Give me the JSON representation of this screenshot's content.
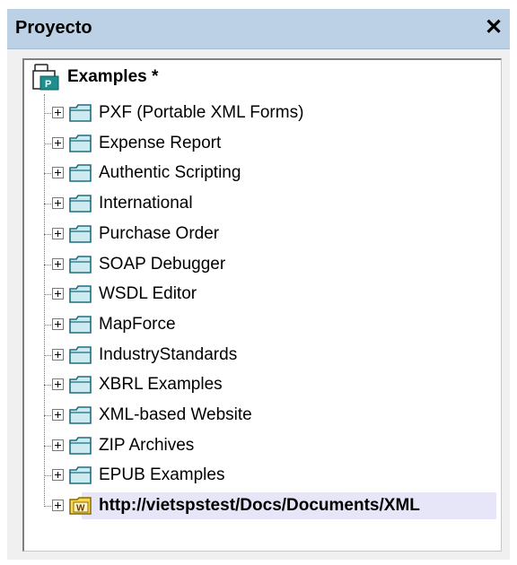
{
  "window": {
    "title": "Proyecto",
    "close_glyph": "✕"
  },
  "tree": {
    "root": {
      "label": "Examples  *",
      "icon": "project-icon"
    },
    "items": [
      {
        "label": "PXF (Portable XML Forms)",
        "icon": "folder-icon"
      },
      {
        "label": "Expense Report",
        "icon": "folder-icon"
      },
      {
        "label": "Authentic Scripting",
        "icon": "folder-icon"
      },
      {
        "label": "International",
        "icon": "folder-icon"
      },
      {
        "label": "Purchase Order",
        "icon": "folder-icon"
      },
      {
        "label": "SOAP Debugger",
        "icon": "folder-icon"
      },
      {
        "label": "WSDL Editor",
        "icon": "folder-icon"
      },
      {
        "label": "MapForce",
        "icon": "folder-icon"
      },
      {
        "label": "IndustryStandards",
        "icon": "folder-icon"
      },
      {
        "label": "XBRL Examples",
        "icon": "folder-icon"
      },
      {
        "label": "XML-based Website",
        "icon": "folder-icon"
      },
      {
        "label": "ZIP Archives",
        "icon": "folder-icon"
      },
      {
        "label": "EPUB Examples",
        "icon": "folder-icon"
      },
      {
        "label": "http://vietspstest/Docs/Documents/XML",
        "icon": "webdav-folder-icon",
        "selected": true
      }
    ]
  },
  "colors": {
    "titlebar": "#bcd0e6",
    "selection": "#e6e6f8",
    "folder_fill": "#cdeaf0",
    "folder_stroke": "#1e6e80",
    "webdav_folder": "#f8d850"
  }
}
